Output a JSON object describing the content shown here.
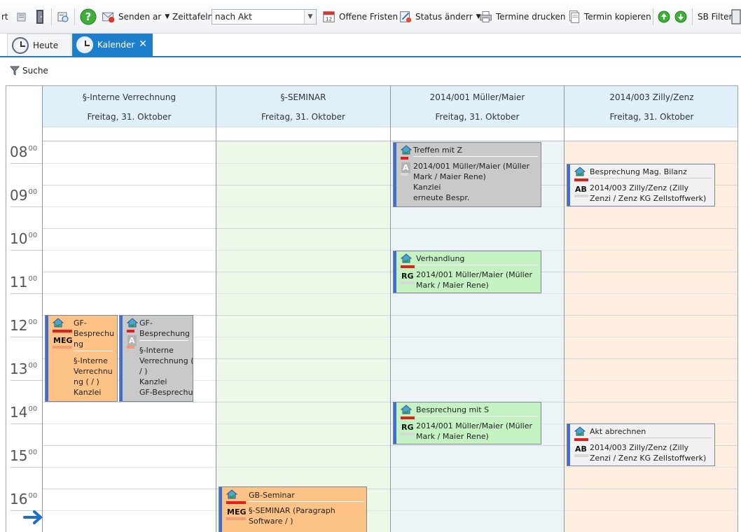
{
  "toolbar": {
    "items": {
      "fragment": "rt",
      "senden": "Senden ar",
      "zeittafeln": "Zeittafeln",
      "zeittafeln_select": "nach Akt",
      "offene_fristen": "Offene Fristen",
      "status": "Status änderr",
      "termine_drucken": "Termine drucken",
      "termin_kopieren": "Termin kopieren",
      "sb_filter": "SB Filter"
    }
  },
  "tabs": [
    {
      "label": "Heute"
    },
    {
      "label": "Kalender"
    }
  ],
  "search": {
    "label": "Suche"
  },
  "columns": [
    {
      "title": "§-Interne Verrechnung",
      "date": "Freitag, 31. Oktober"
    },
    {
      "title": "§-SEMINAR",
      "date": "Freitag, 31. Oktober"
    },
    {
      "title": "2014/001 Müller/Maier",
      "date": "Freitag, 31. Oktober"
    },
    {
      "title": "2014/003 Zilly/Zenz",
      "date": "Freitag, 31. Oktober"
    }
  ],
  "hours": [
    {
      "h": "08",
      "m": "00"
    },
    {
      "h": "09",
      "m": "00"
    },
    {
      "h": "10",
      "m": "00"
    },
    {
      "h": "11",
      "m": "00"
    },
    {
      "h": "12",
      "m": "00"
    },
    {
      "h": "13",
      "m": "00"
    },
    {
      "h": "14",
      "m": "00"
    },
    {
      "h": "15",
      "m": "00"
    },
    {
      "h": "16",
      "m": "00"
    }
  ],
  "appointments": {
    "gf1": {
      "title": "GF-\nBesprechu\nng",
      "code": "MEG",
      "body": "§-Interne\nVerrechnu\nng ( / )\nKanzlei"
    },
    "gf2": {
      "title": "GF-\nBesprechung",
      "code": "A",
      "body": "§-Interne\nVerrechnung (\n/ )\nKanzlei\nGF-Besprechu"
    },
    "gb": {
      "title": "GB-Seminar",
      "code": "MEG",
      "body": "§-SEMINAR (Paragraph\nSoftware / )"
    },
    "treffen": {
      "title": "Treffen mit Z",
      "code": "A",
      "body": "2014/001 Müller/Maier (Müller\nMark / Maier Rene)\nKanzlei\nerneute Bespr."
    },
    "verhandlung": {
      "title": "Verhandlung",
      "code": "RG",
      "body": "2014/001 Müller/Maier (Müller\nMark / Maier Rene)"
    },
    "bespr_s": {
      "title": "Besprechung mit S",
      "code": "RG",
      "body": "2014/001 Müller/Maier (Müller\nMark / Maier Rene)"
    },
    "bilanz": {
      "title": "Besprechung Mag. Bilanz",
      "code": "AB",
      "body": "2014/003 Zilly/Zenz (Zilly\nZenzi / Zenz KG Zellstoffwerk)"
    },
    "abrechnen": {
      "title": "Akt abrechnen",
      "code": "AB",
      "body": "2014/003 Zilly/Zenz (Zilly\nZenzi / Zenz KG Zellstoffwerk)"
    }
  }
}
